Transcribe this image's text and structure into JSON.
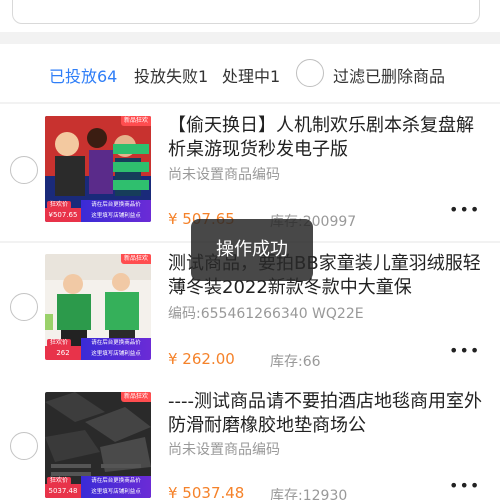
{
  "tabs": {
    "placed": "已投放64",
    "failed": "投放失败1",
    "processing": "处理中1",
    "filter_deleted": "过滤已删除商品"
  },
  "colors": {
    "accent": "#2f7ef7",
    "price": "#f5822a",
    "muted": "#999999"
  },
  "items": [
    {
      "title": "【偷天换日】人机制欢乐剧本杀复盘解析桌游现货秒发电子版",
      "subtitle": "尚未设置商品编码",
      "price": "¥ 507.65",
      "stock": "库存:200997",
      "thumb": {
        "pill": "¥507.65",
        "badge": "狂欢价",
        "tag": "新品狂欢",
        "strip_1": "请在后台更换商品价",
        "strip_2": "这里填写店铺利益点"
      }
    },
    {
      "title": "测试商品，要拍BB家童装儿童羽绒服轻薄冬装2022新款冬款中大童保",
      "subtitle": "编码:655461266340 WQ22E",
      "price": "¥ 262.00",
      "stock": "库存:66",
      "thumb": {
        "pill": "262",
        "badge": "狂欢价",
        "tag": "新品狂欢",
        "strip_1": "请在后台更换商品价",
        "strip_2": "这里填写店铺利益点"
      }
    },
    {
      "title": "----测试商品请不要拍酒店地毯商用室外防滑耐磨橡胶地垫商场公",
      "subtitle": "尚未设置商品编码",
      "price": "¥ 5037.48",
      "stock": "库存:12930",
      "thumb": {
        "pill": "5037.48",
        "badge": "狂欢价",
        "tag": "新品狂欢",
        "strip_1": "请在后台更换商品价",
        "strip_2": "这里填写店铺利益点"
      }
    }
  ],
  "toast": "操作成功",
  "more_icon": "ellipsis-icon"
}
